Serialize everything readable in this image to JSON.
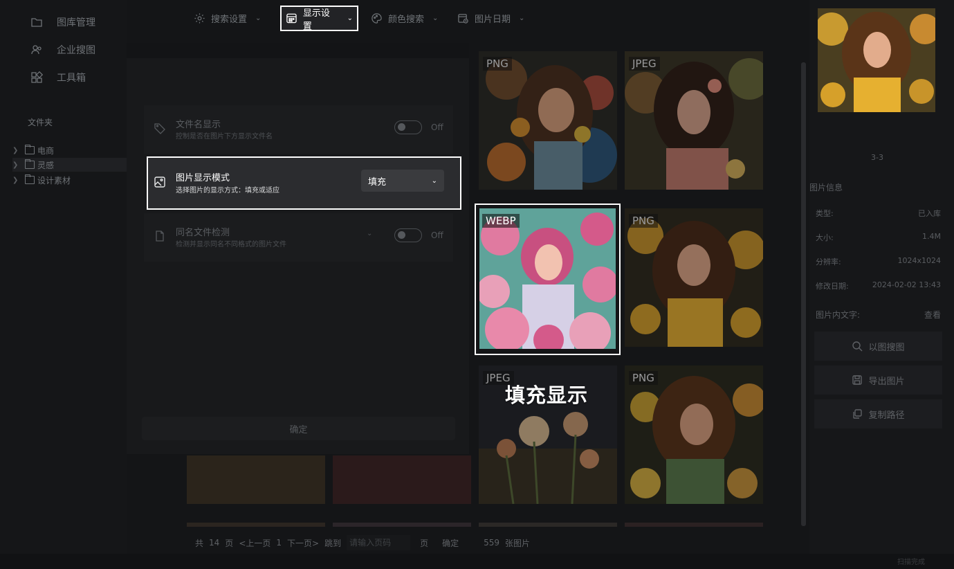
{
  "sidebar": {
    "nav": [
      {
        "label": "图库管理",
        "icon": "folder-icon"
      },
      {
        "label": "企业搜图",
        "icon": "users-icon"
      },
      {
        "label": "工具箱",
        "icon": "toolbox-icon"
      }
    ],
    "folder_title": "文件夹",
    "tree": [
      {
        "label": "电商",
        "selected": false
      },
      {
        "label": "灵感",
        "selected": true
      },
      {
        "label": "设计素材",
        "selected": false
      }
    ]
  },
  "toolbar": {
    "items": [
      {
        "label": "搜索设置",
        "icon": "gear-icon",
        "active": false
      },
      {
        "label": "显示设置",
        "icon": "calendar-grid-icon",
        "active": true
      },
      {
        "label": "颜色搜索",
        "icon": "palette-icon",
        "active": false
      },
      {
        "label": "图片日期",
        "icon": "calendar-clock-icon",
        "active": false
      }
    ]
  },
  "settings": {
    "rows": [
      {
        "title": "文件名显示",
        "desc": "控制是否在图片下方显示文件名",
        "toggle": "Off",
        "icon": "tag-icon"
      },
      {
        "title": "图片显示模式",
        "desc": "选择图片的显示方式：填充或适应",
        "select_value": "填充",
        "icon": "image-icon"
      },
      {
        "title": "同名文件检测",
        "desc": "检测并显示同名不同格式的图片文件",
        "toggle": "Off",
        "icon": "file-icon"
      }
    ],
    "confirm": "确定"
  },
  "grid": {
    "tiles": [
      {
        "format": "PNG"
      },
      {
        "format": "JPEG"
      },
      {
        "format": "WEBP"
      },
      {
        "format": "PNG"
      },
      {
        "format": "JPEG"
      },
      {
        "format": "PNG"
      }
    ],
    "overlay_label": "填充显示"
  },
  "pager": {
    "total_prefix": "共",
    "total_pages": "14",
    "page_unit": "页",
    "prev": "<上一页",
    "current": "1",
    "next": "下一页>",
    "jump": "跳到",
    "input_placeholder": "请输入页码",
    "page_suffix": "页",
    "confirm": "确定",
    "image_count": "559",
    "image_unit": "张图片"
  },
  "detail": {
    "counter": "3-3",
    "section_title": "图片信息",
    "fields": [
      {
        "k": "类型:",
        "v": "已入库"
      },
      {
        "k": "大小:",
        "v": "1.4M"
      },
      {
        "k": "分辨率:",
        "v": "1024x1024"
      },
      {
        "k": "修改日期:",
        "v": "2024-02-02 13:43"
      }
    ],
    "ocr": {
      "k": "图片内文字:",
      "v": "查看"
    },
    "buttons": [
      {
        "label": "以图搜图",
        "icon": "search-icon"
      },
      {
        "label": "导出图片",
        "icon": "save-icon"
      },
      {
        "label": "复制路径",
        "icon": "copy-icon"
      }
    ]
  },
  "status": "扫描完成"
}
